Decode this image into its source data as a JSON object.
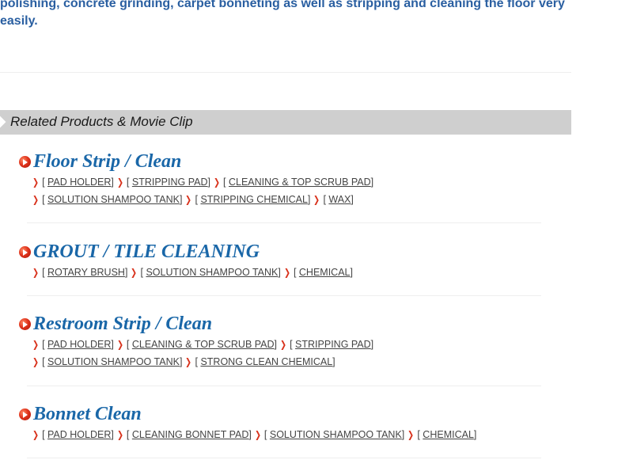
{
  "intro": {
    "text": "polishing, concrete grinding, carpet bonneting as well as stripping and cleaning the floor very easily."
  },
  "related": {
    "title": "Related Products & Movie Clip"
  },
  "groups": [
    {
      "title": "Floor Strip / Clean",
      "rows": [
        [
          "PAD HOLDER",
          "STRIPPING PAD",
          "CLEANING & TOP SCRUB PAD"
        ],
        [
          "SOLUTION SHAMPOO TANK",
          "STRIPPING CHEMICAL",
          "WAX"
        ]
      ]
    },
    {
      "title": "GROUT / TILE CLEANING",
      "rows": [
        [
          "ROTARY BRUSH",
          "SOLUTION SHAMPOO TANK",
          "CHEMICAL"
        ]
      ]
    },
    {
      "title": "Restroom Strip / Clean",
      "rows": [
        [
          "PAD HOLDER",
          "CLEANING & TOP SCRUB PAD",
          "STRIPPING PAD"
        ],
        [
          "SOLUTION SHAMPOO TANK",
          "STRONG CLEAN CHEMICAL"
        ]
      ]
    },
    {
      "title": "Bonnet Clean",
      "rows": [
        [
          "PAD HOLDER",
          "CLEANING BONNET PAD",
          "SOLUTION SHAMPOO TANK",
          "CHEMICAL"
        ]
      ]
    }
  ],
  "colors": {
    "title_blue": "#1a67a8",
    "intro_blue": "#2a5fa1",
    "bar_gray": "#cfcfcf",
    "bullet_red": "#e0341c"
  },
  "icons": {
    "bullet": "red-play-circle-icon",
    "link_marker": "red-chevron-right-icon"
  }
}
